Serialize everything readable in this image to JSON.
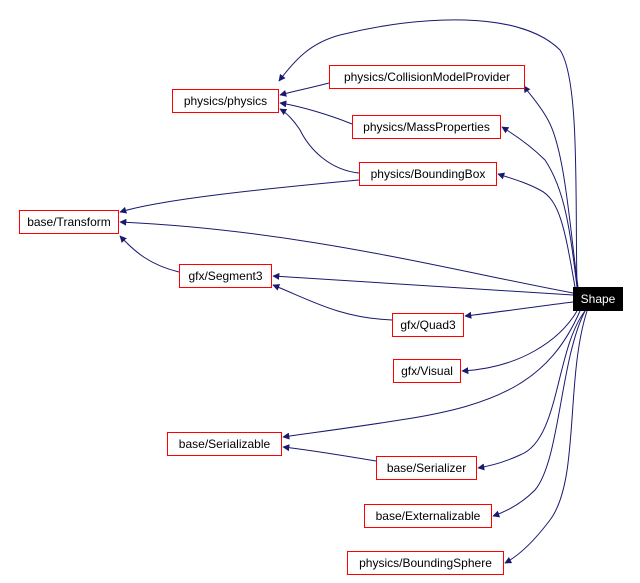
{
  "diagram": {
    "type": "include-dependency-graph",
    "colors": {
      "edge": "#191970",
      "node_border": "#ff0000",
      "root_bg": "#000000",
      "root_text": "#ffffff"
    },
    "root": "Shape",
    "nodes": [
      {
        "id": "shape",
        "label": "Shape"
      },
      {
        "id": "physics",
        "label": "physics/physics"
      },
      {
        "id": "collision",
        "label": "physics/CollisionModelProvider"
      },
      {
        "id": "mass",
        "label": "physics/MassProperties"
      },
      {
        "id": "bbox",
        "label": "physics/BoundingBox"
      },
      {
        "id": "transform",
        "label": "base/Transform"
      },
      {
        "id": "segment3",
        "label": "gfx/Segment3"
      },
      {
        "id": "quad3",
        "label": "gfx/Quad3"
      },
      {
        "id": "visual",
        "label": "gfx/Visual"
      },
      {
        "id": "serializable",
        "label": "base/Serializable"
      },
      {
        "id": "serializer",
        "label": "base/Serializer"
      },
      {
        "id": "externalizable",
        "label": "base/Externalizable"
      },
      {
        "id": "bsphere",
        "label": "physics/BoundingSphere"
      }
    ],
    "edges": [
      {
        "from": "shape",
        "to": "physics"
      },
      {
        "from": "shape",
        "to": "collision"
      },
      {
        "from": "shape",
        "to": "mass"
      },
      {
        "from": "shape",
        "to": "bbox"
      },
      {
        "from": "shape",
        "to": "transform"
      },
      {
        "from": "shape",
        "to": "segment3"
      },
      {
        "from": "shape",
        "to": "quad3"
      },
      {
        "from": "shape",
        "to": "visual"
      },
      {
        "from": "shape",
        "to": "serializable"
      },
      {
        "from": "shape",
        "to": "serializer"
      },
      {
        "from": "shape",
        "to": "externalizable"
      },
      {
        "from": "shape",
        "to": "bsphere"
      },
      {
        "from": "collision",
        "to": "physics"
      },
      {
        "from": "mass",
        "to": "physics"
      },
      {
        "from": "bbox",
        "to": "physics"
      },
      {
        "from": "bbox",
        "to": "transform"
      },
      {
        "from": "segment3",
        "to": "transform"
      },
      {
        "from": "quad3",
        "to": "segment3"
      },
      {
        "from": "serializer",
        "to": "serializable"
      }
    ]
  }
}
